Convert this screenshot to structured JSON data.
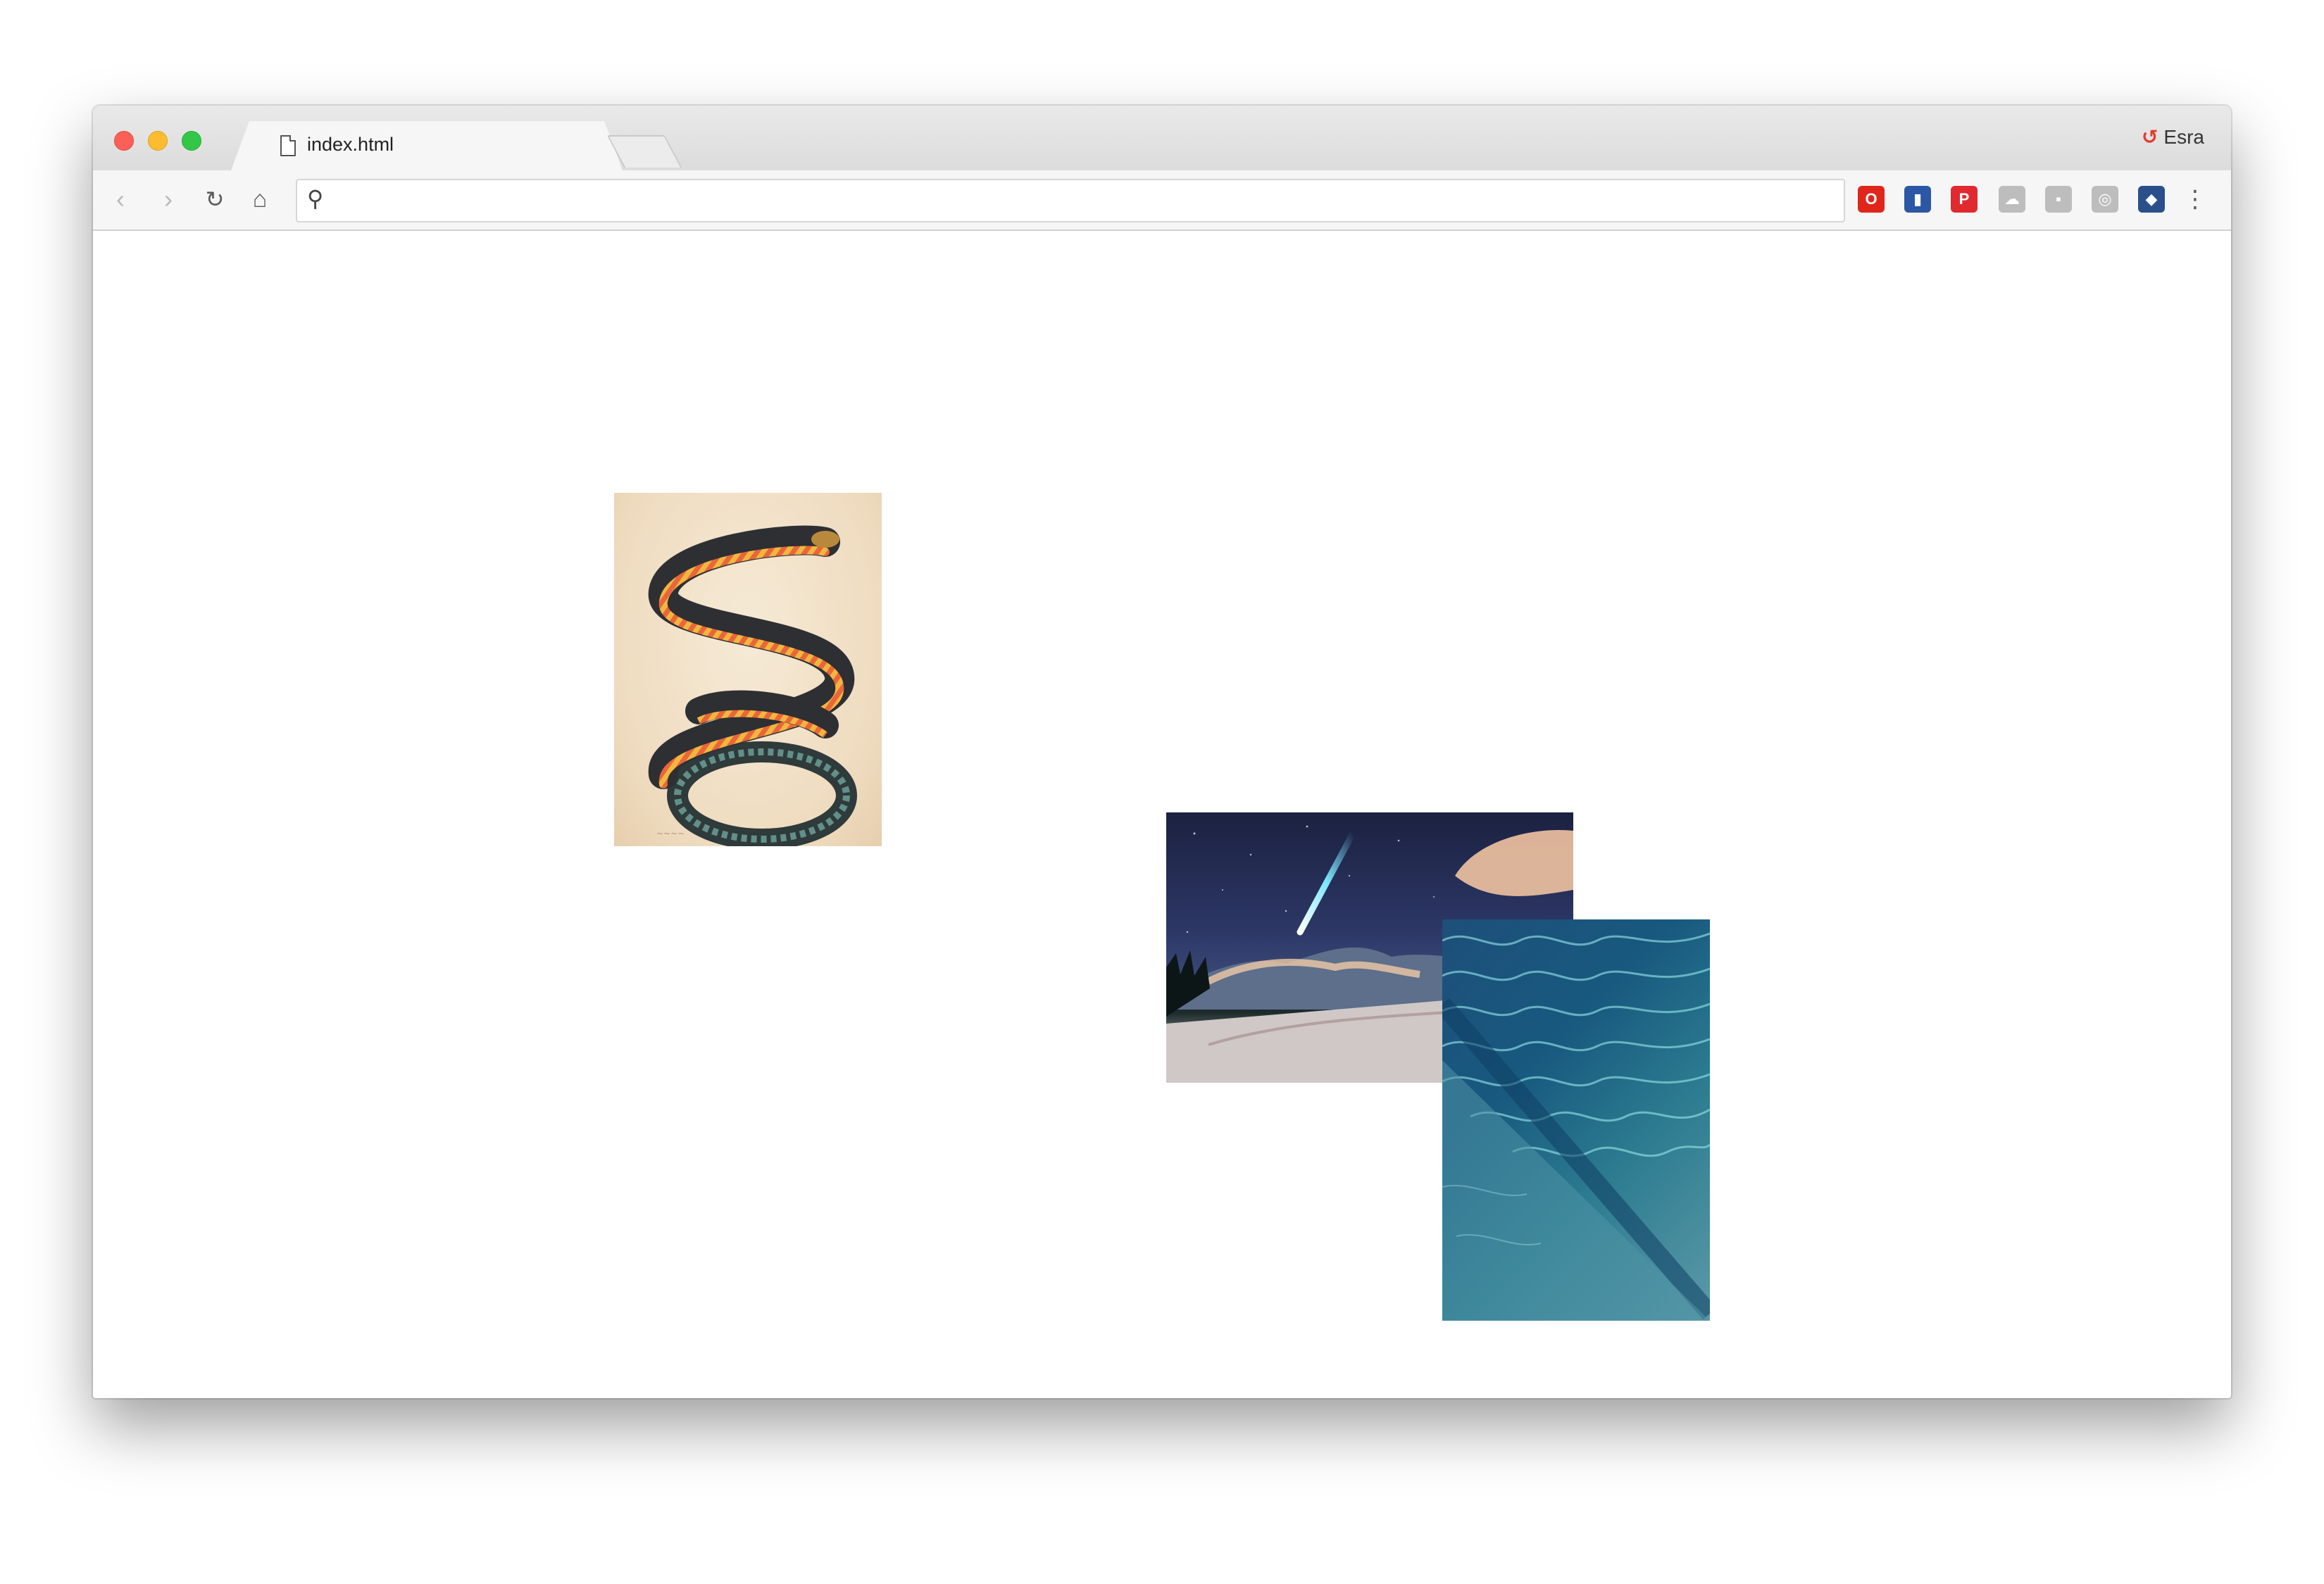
{
  "browser": {
    "tab": {
      "title": "index.html",
      "close_glyph": "×"
    },
    "profile": {
      "icon": "profile-badge-icon",
      "name": "Esra"
    },
    "toolbar": {
      "back_glyph": "‹",
      "forward_glyph": "›",
      "reload_glyph": "↻",
      "home_glyph": "⌂",
      "address_value": "",
      "search_glyph": "⚲",
      "menu_glyph": "⋮"
    },
    "extensions": [
      {
        "icon": "opera-icon",
        "glyph": "O",
        "color": "#e0261b"
      },
      {
        "icon": "chart-extension-icon",
        "glyph": "▮",
        "color": "#2b57a5"
      },
      {
        "icon": "pinterest-icon",
        "glyph": "P",
        "color": "#e02a30"
      },
      {
        "icon": "cloud-extension-icon",
        "glyph": "☁",
        "color": "#bdbdbd"
      },
      {
        "icon": "square-extension-icon",
        "glyph": "▪",
        "color": "#bdbdbd"
      },
      {
        "icon": "circle-extension-icon",
        "glyph": "◎",
        "color": "#bdbdbd"
      },
      {
        "icon": "blue-extension-icon",
        "glyph": "◆",
        "color": "#2b4f8a"
      }
    ]
  },
  "page": {
    "images": [
      {
        "subject": "coiled-snake-illustration"
      },
      {
        "subject": "meteor-night-sky-landscape"
      },
      {
        "subject": "rippled-water-surface"
      }
    ]
  }
}
